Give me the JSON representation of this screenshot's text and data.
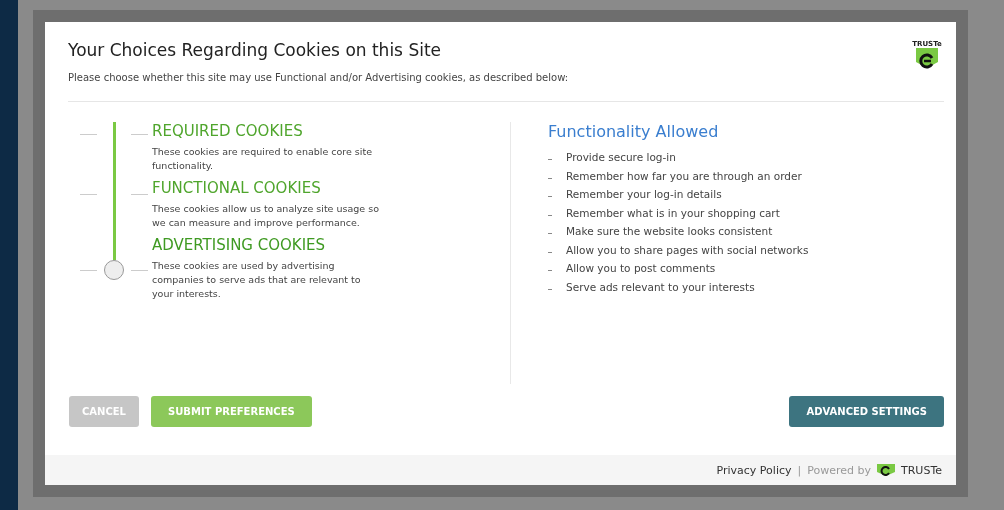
{
  "dialog": {
    "title": "Your Choices Regarding Cookies on this Site",
    "subtitle": "Please choose whether this site may use Functional and/or Advertising cookies, as described below:",
    "logo_text": "TRUSTe"
  },
  "levels": [
    {
      "title": "REQUIRED COOKIES",
      "description": "These cookies are required to enable core site functionality.",
      "selected": false
    },
    {
      "title": "FUNCTIONAL COOKIES",
      "description": "These cookies allow us to analyze site usage so we can measure and improve performance.",
      "selected": false
    },
    {
      "title": "ADVERTISING COOKIES",
      "description": "These cookies are used by advertising companies to serve ads that are relevant to your interests.",
      "selected": true
    }
  ],
  "functionality": {
    "heading": "Functionality Allowed",
    "items": [
      "Provide secure log-in",
      "Remember how far you are through an order",
      "Remember your log-in details",
      "Remember what is in your shopping cart",
      "Make sure the website looks consistent",
      "Allow you to share pages with social networks",
      "Allow you to post comments",
      "Serve ads relevant to your interests"
    ]
  },
  "buttons": [
    {
      "label": "CANCEL",
      "kind": "cancel"
    },
    {
      "label": "SUBMIT PREFERENCES",
      "kind": "submit"
    },
    {
      "label": "ADVANCED SETTINGS",
      "kind": "advanced"
    }
  ],
  "footer": {
    "privacy_link": "Privacy Policy",
    "separator": "|",
    "powered_by": "Powered by",
    "brand": "TRUSTe"
  }
}
